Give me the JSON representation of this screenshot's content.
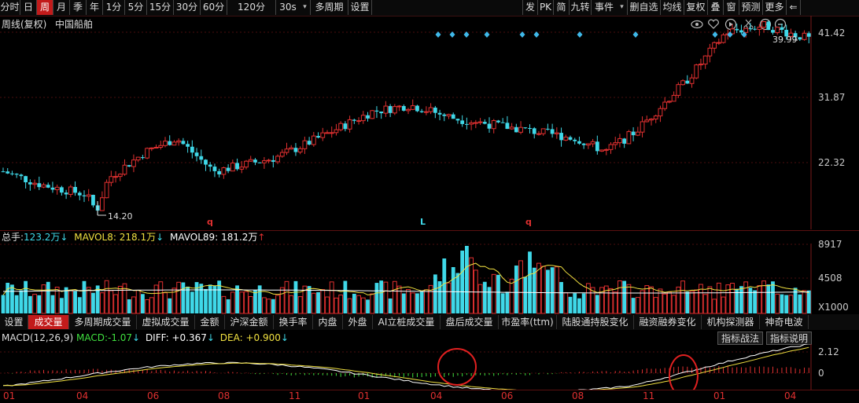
{
  "toolbar": {
    "left": [
      "分时",
      "日",
      "周",
      "月",
      "季",
      "年",
      "1分",
      "5分",
      "15分",
      "30分",
      "60分",
      "120分",
      "30s",
      "▾",
      "多周期",
      "设置"
    ],
    "active_index": 2,
    "right": [
      "发",
      "PK",
      "简",
      "九转",
      "事件",
      "▾",
      "删自选",
      "均线",
      "复权",
      "叠",
      "窗",
      "预测",
      "更多",
      "⇐"
    ]
  },
  "chart": {
    "title": "周线(复权)",
    "stock_name": "中国船舶",
    "prices": [
      "41.42",
      "31.87",
      "22.32"
    ],
    "high_marker": "39.99",
    "low_marker": "14.20",
    "signals": [
      "q",
      "L",
      "q"
    ],
    "top_icons": [
      "eye-icon",
      "heart-icon",
      "play-icon",
      "scissors-icon",
      "zoom-in-icon",
      "zoom-out-icon"
    ]
  },
  "volume": {
    "label_total": "总手:",
    "total_value": "123.2万",
    "total_arrow": "↓",
    "mavol8_label": "MAVOL8:",
    "mavol8_value": "218.1万",
    "mavol8_arrow": "↓",
    "mavol89_label": "MAVOL89:",
    "mavol89_value": "181.2万",
    "mavol89_arrow": "↑",
    "ticks": [
      "8917",
      "4508"
    ],
    "unit": "X1000"
  },
  "indicator_tabs": {
    "items": [
      "设置",
      "成交量",
      "多周期成交量",
      "虚拟成交量",
      "金额",
      "沪深金额",
      "换手率",
      "内盘",
      "外盘",
      "AI立桩成交量",
      "盘后成交量",
      "市盈率(ttm)",
      "陆股通持股变化",
      "融资融券变化",
      "机构探测器",
      "神奇电波"
    ],
    "active_index": 1
  },
  "macd": {
    "title": "MACD(12,26,9)",
    "macd_label": "MACD:",
    "macd_value": "-1.07",
    "macd_arrow": "↓",
    "diff_label": "DIFF:",
    "diff_value": "+0.367",
    "diff_arrow": "↓",
    "dea_label": "DEA:",
    "dea_value": "+0.900",
    "dea_arrow": "↓",
    "ticks": [
      "2.12",
      "0"
    ],
    "strategy_button": "指标战法",
    "help_button": "指标说明"
  },
  "x_axis": [
    "01",
    "04",
    "06",
    "08",
    "11",
    "01",
    "04",
    "06",
    "08",
    "11",
    "01",
    "04"
  ],
  "colors": {
    "up": "#e03030",
    "down": "#3fd8e8",
    "diff_line": "#ffffff",
    "dea_line": "#f0e040",
    "accent": "#c21b1b"
  }
}
